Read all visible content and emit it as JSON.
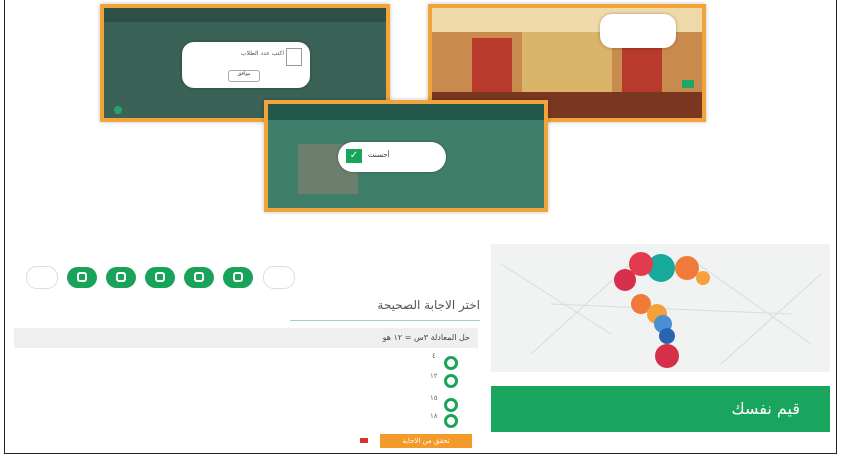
{
  "page": {
    "progress_indicators": [
      "empty",
      "correct",
      "correct",
      "correct",
      "correct",
      "correct",
      "empty"
    ],
    "question_heading": "اختر الاجابة الصحيحة",
    "question_text": "حل المعادلة ٣س = ١٢ هو",
    "options": [
      "٤",
      "١٢",
      "١٥",
      "١٨"
    ],
    "submit_label": "تحقق من الاجابة",
    "self_eval_title": "قيم نفسك"
  },
  "screens": {
    "left_dialog": "اكتب عدد الطلاب",
    "left_button": "موافق",
    "bottom_dialog": "أحسنت"
  },
  "colors": {
    "accent_orange": "#f2a33a",
    "green": "#1aa35a"
  }
}
